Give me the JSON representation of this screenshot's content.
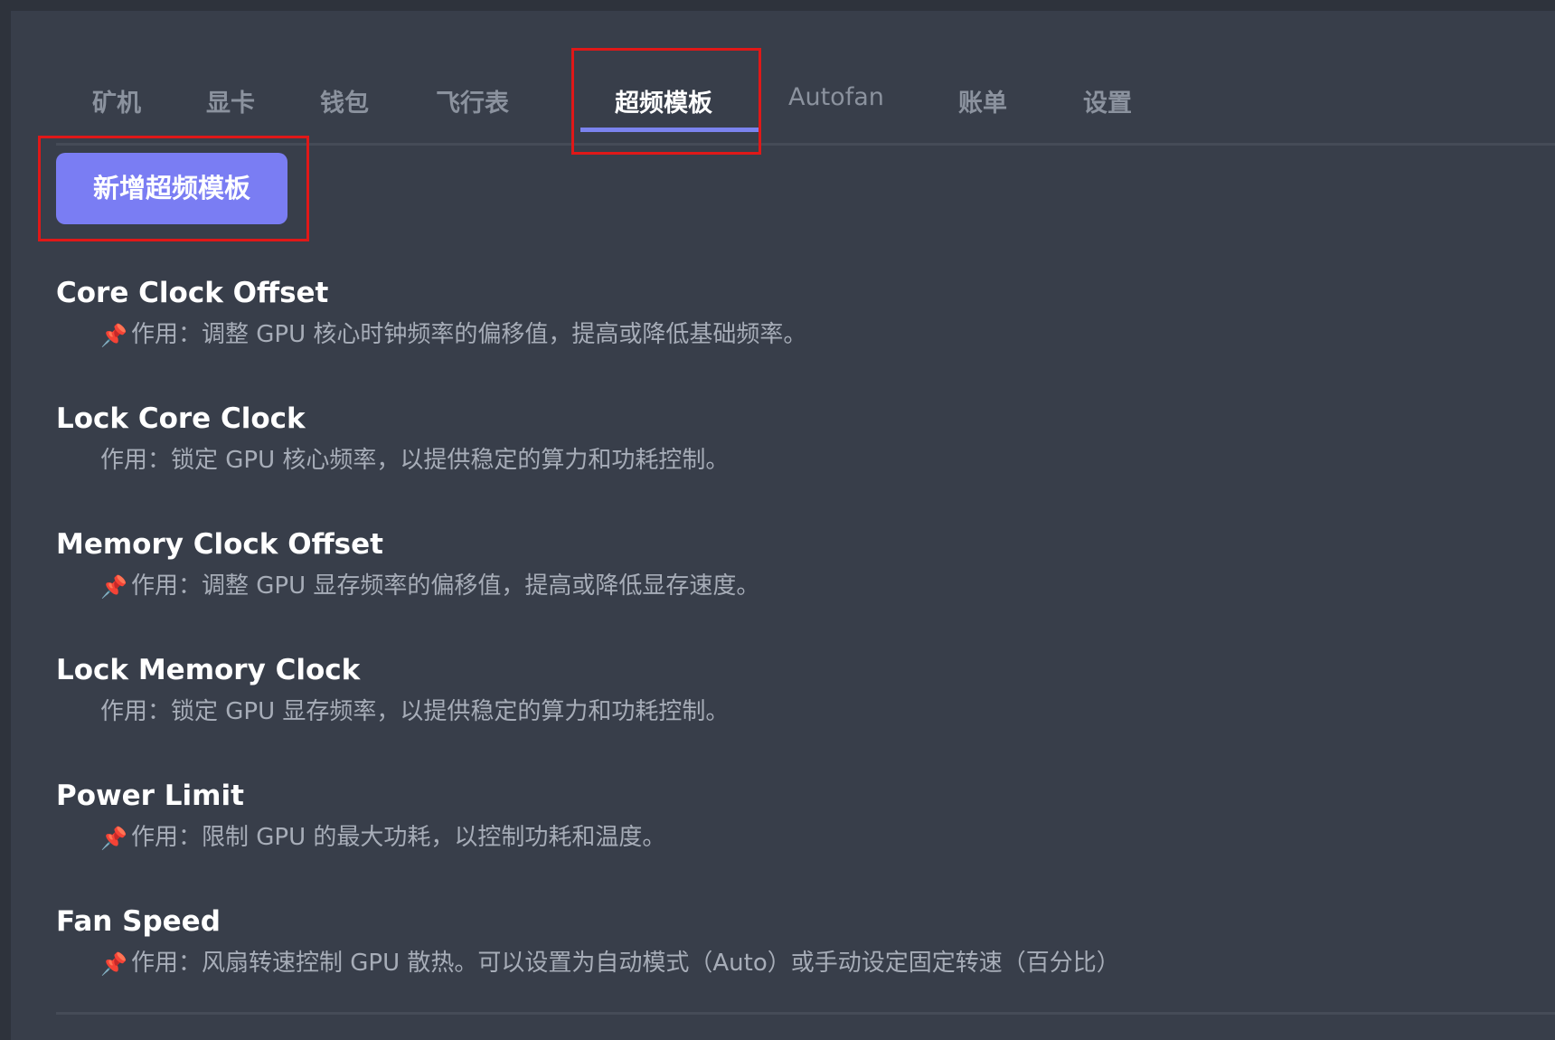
{
  "tabs": [
    {
      "label": "矿机",
      "active": false
    },
    {
      "label": "显卡",
      "active": false
    },
    {
      "label": "钱包",
      "active": false
    },
    {
      "label": "飞行表",
      "active": false
    },
    {
      "label": "超频模板",
      "active": true
    },
    {
      "label": "Autofan",
      "active": false
    },
    {
      "label": "账单",
      "active": false
    },
    {
      "label": "设置",
      "active": false
    }
  ],
  "add_button": "新增超频模板",
  "items": [
    {
      "title": "Core Clock Offset",
      "pin": "📌",
      "desc": "作用：调整 GPU 核心时钟频率的偏移值，提高或降低基础频率。"
    },
    {
      "title": "Lock Core Clock",
      "pin": "",
      "desc": "作用：锁定 GPU 核心频率，以提供稳定的算力和功耗控制。"
    },
    {
      "title": "Memory Clock Offset",
      "pin": "📌",
      "desc": "作用：调整 GPU 显存频率的偏移值，提高或降低显存速度。"
    },
    {
      "title": "Lock Memory Clock",
      "pin": "",
      "desc": "作用：锁定 GPU 显存频率，以提供稳定的算力和功耗控制。"
    },
    {
      "title": "Power Limit",
      "pin": "📌",
      "desc": "作用：限制 GPU 的最大功耗，以控制功耗和温度。"
    },
    {
      "title": "Fan Speed",
      "pin": "📌",
      "desc": "作用：风扇转速控制 GPU 散热。可以设置为自动模式（Auto）或手动设定固定转速（百分比）"
    }
  ],
  "colors": {
    "background": "#383e4a",
    "accent": "#7a7df3",
    "highlight_box": "#e01818"
  }
}
